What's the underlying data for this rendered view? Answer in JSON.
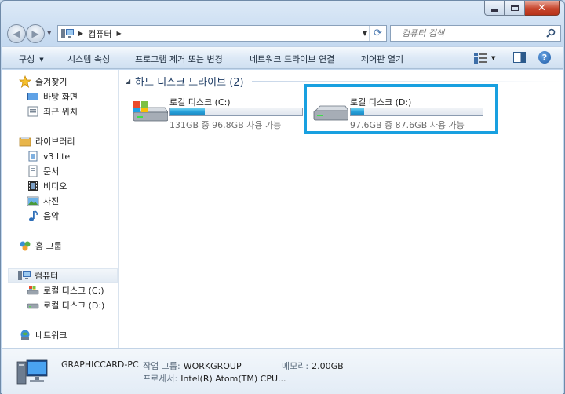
{
  "window": {
    "caption_close": "✕"
  },
  "address_bar": {
    "path": "컴퓨터",
    "separator_1": "▶",
    "separator_2": "▶",
    "search_placeholder": "컴퓨터 검색"
  },
  "command_bar": {
    "organize": "구성",
    "system_properties": "시스템 속성",
    "uninstall": "프로그램 제거 또는 변경",
    "map_network_drive": "네트워크 드라이브 연결",
    "control_panel": "제어판 열기"
  },
  "nav_pane": {
    "favorites": {
      "label": "즐겨찾기",
      "items": [
        "바탕 화면",
        "최근 위치"
      ]
    },
    "libraries": {
      "label": "라이브러리",
      "items": [
        "v3 lite",
        "문서",
        "비디오",
        "사진",
        "음악"
      ]
    },
    "homegroup": "홈 그룹",
    "computer": {
      "label": "컴퓨터",
      "items": [
        "로컬 디스크 (C:)",
        "로컬 디스크 (D:)"
      ]
    },
    "network": "네트워크"
  },
  "content": {
    "group_header": "하드 디스크 드라이브 (2)",
    "drives": [
      {
        "name": "로컬 디스크 (C:)",
        "free_text": "131GB 중 96.8GB 사용 가능",
        "used_fraction": 0.26
      },
      {
        "name": "로컬 디스크 (D:)",
        "free_text": "97.6GB 중 87.6GB 사용 가능",
        "used_fraction": 0.1
      }
    ]
  },
  "details": {
    "computer_name": "GRAPHICCARD-PC",
    "workgroup_label": "작업 그룹:",
    "workgroup_value": "WORKGROUP",
    "memory_label": "메모리:",
    "memory_value": "2.00GB",
    "processor_label": "프로세서:",
    "processor_value": "Intel(R) Atom(TM) CPU..."
  },
  "colors": {
    "highlight": "#18a0e0",
    "drive_fill": "#26a0da"
  }
}
